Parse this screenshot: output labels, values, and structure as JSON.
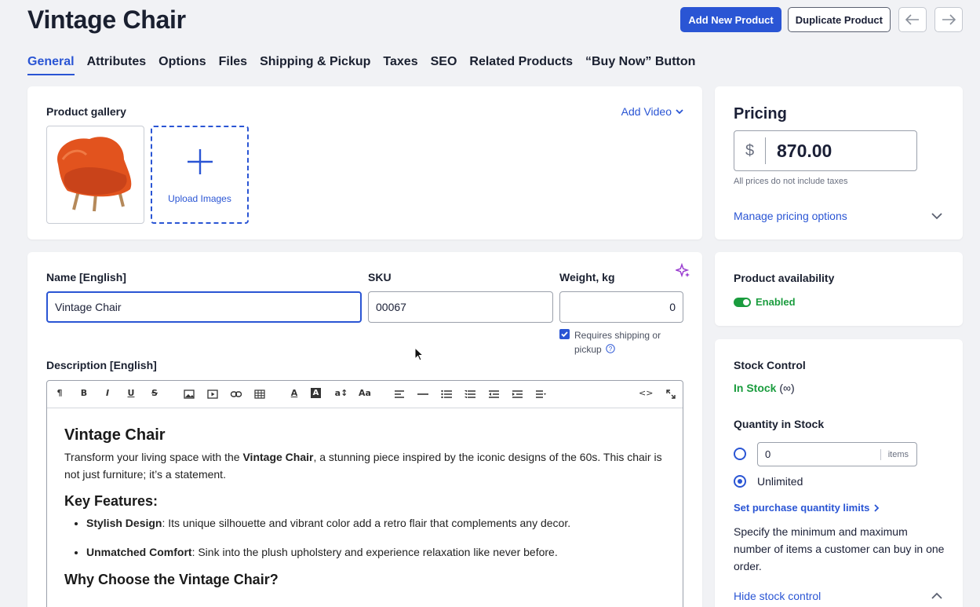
{
  "header": {
    "title": "Vintage Chair",
    "add_new_label": "Add New Product",
    "duplicate_label": "Duplicate Product"
  },
  "tabs": [
    {
      "label": "General"
    },
    {
      "label": "Attributes"
    },
    {
      "label": "Options"
    },
    {
      "label": "Files"
    },
    {
      "label": "Shipping & Pickup"
    },
    {
      "label": "Taxes"
    },
    {
      "label": "SEO"
    },
    {
      "label": "Related Products"
    },
    {
      "label": "“Buy Now” Button"
    }
  ],
  "gallery": {
    "label": "Product gallery",
    "add_video": "Add Video",
    "upload_label": "Upload Images"
  },
  "form": {
    "name_label": "Name [English]",
    "name_value": "Vintage Chair",
    "sku_label": "SKU",
    "sku_value": "00067",
    "weight_label": "Weight, kg",
    "weight_value": "0",
    "shipping_label": "Requires shipping or pickup",
    "description_label": "Description [English]"
  },
  "editor": {
    "toolbar": [
      "¶",
      "B",
      "I",
      "U",
      "S",
      "image",
      "video",
      "link",
      "table",
      "A",
      "A",
      "a↕",
      "Aa",
      "align",
      "hr",
      "ul",
      "ol",
      "outdent",
      "indent",
      "more",
      "<>",
      "expand"
    ],
    "heading": "Vintage Chair",
    "intro_1": "Transform your living space with the ",
    "intro_bold": "Vintage Chair",
    "intro_2": ", a stunning piece inspired by the iconic designs of the 60s. This chair is not just furniture; it’s a statement.",
    "features_heading": "Key Features:",
    "feature_1_bold": "Stylish Design",
    "feature_1_text": ": Its unique silhouette and vibrant color add a retro flair that complements any decor.",
    "feature_2_bold": "Unmatched Comfort",
    "feature_2_text": ": Sink into the plush upholstery and experience relaxation like never before.",
    "why_heading": "Why Choose the Vintage Chair?"
  },
  "pricing": {
    "title": "Pricing",
    "currency": "$",
    "price": "870.00",
    "note": "All prices do not include taxes",
    "manage_label": "Manage pricing options"
  },
  "availability": {
    "title": "Product availability",
    "status": "Enabled"
  },
  "stock": {
    "title": "Stock Control",
    "status": "In Stock",
    "status_suffix": "(∞)",
    "qty_title": "Quantity in Stock",
    "qty_value": "0",
    "qty_unit": "items",
    "unlimited_label": "Unlimited",
    "limits_label": "Set purchase quantity limits",
    "limits_desc": "Specify the minimum and maximum number of items a customer can buy in one order.",
    "hide_label": "Hide stock control"
  },
  "colors": {
    "accent": "#2a55d4",
    "success": "#1a9c3e"
  }
}
